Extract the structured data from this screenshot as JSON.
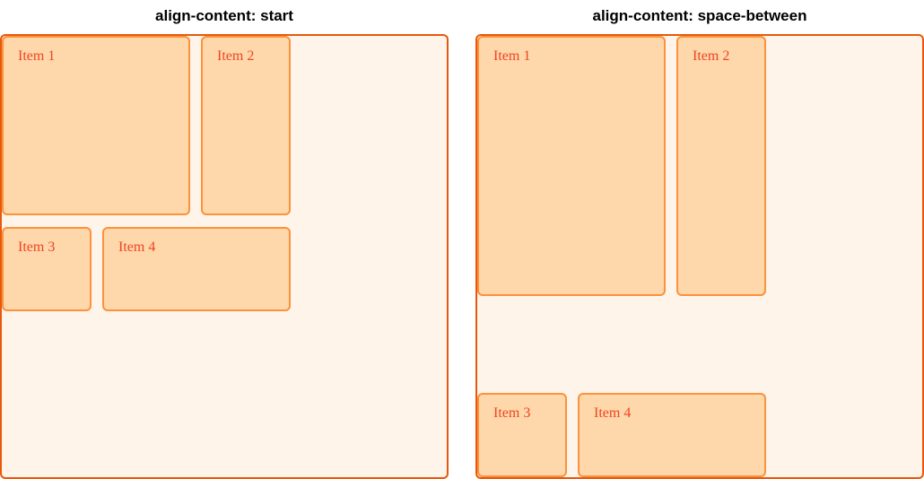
{
  "panels": [
    {
      "title": "align-content: start",
      "items": [
        "Item 1",
        "Item 2",
        "Item 3",
        "Item 4"
      ]
    },
    {
      "title": "align-content: space-between",
      "items": [
        "Item 1",
        "Item 2",
        "Item 3",
        "Item 4"
      ]
    }
  ],
  "colors": {
    "container_bg": "#fff4ea",
    "container_border": "#ea580c",
    "item_bg": "#fed7aa",
    "item_border": "#fb923c",
    "item_text": "#ef4423"
  },
  "chart_data": {
    "type": "table",
    "description": "Two CSS grid containers demonstrating align-content values",
    "containers": [
      {
        "align_content": "start",
        "rows_packed_to": "top",
        "items": [
          {
            "label": "Item 1",
            "row": 1,
            "approx_width": 210,
            "approx_height": 200
          },
          {
            "label": "Item 2",
            "row": 1,
            "approx_width": 100,
            "approx_height": 200
          },
          {
            "label": "Item 3",
            "row": 2,
            "approx_width": 100,
            "approx_height": 94
          },
          {
            "label": "Item 4",
            "row": 2,
            "approx_width": 210,
            "approx_height": 94
          }
        ]
      },
      {
        "align_content": "space-between",
        "rows_packed_to": "top-and-bottom",
        "items": [
          {
            "label": "Item 1",
            "row": 1,
            "approx_width": 210,
            "approx_height": 290
          },
          {
            "label": "Item 2",
            "row": 1,
            "approx_width": 100,
            "approx_height": 290
          },
          {
            "label": "Item 3",
            "row": 2,
            "approx_width": 100,
            "approx_height": 94
          },
          {
            "label": "Item 4",
            "row": 2,
            "approx_width": 210,
            "approx_height": 94
          }
        ]
      }
    ]
  }
}
